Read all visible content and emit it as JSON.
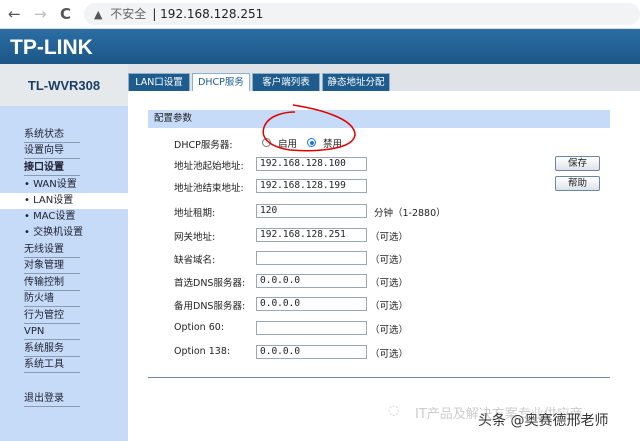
{
  "browser": {
    "back_icon": "←",
    "forward_icon": "→",
    "reload_icon": "C",
    "security_label": "不安全",
    "url": "192.168.128.251"
  },
  "header": {
    "logo": "TP-LINK",
    "model": "TL-WVR308"
  },
  "tabs": [
    {
      "label": "LAN口设置"
    },
    {
      "label": "DHCP服务",
      "active": true
    },
    {
      "label": "客户端列表"
    },
    {
      "label": "静态地址分配"
    }
  ],
  "sidebar": [
    {
      "label": "系统状态"
    },
    {
      "label": "设置向导"
    },
    {
      "label": "接口设置",
      "bold": true
    },
    {
      "label": "• WAN设置"
    },
    {
      "label": "• LAN设置",
      "selected": true
    },
    {
      "label": "• MAC设置"
    },
    {
      "label": "• 交换机设置"
    },
    {
      "label": "无线设置"
    },
    {
      "label": "对象管理"
    },
    {
      "label": "传输控制"
    },
    {
      "label": "防火墙"
    },
    {
      "label": "行为管控"
    },
    {
      "label": "VPN"
    },
    {
      "label": "系统服务"
    },
    {
      "label": "系统工具"
    },
    {
      "label": "退出登录"
    }
  ],
  "panel": {
    "title": "配置参数",
    "dhcp_label": "DHCP服务器:",
    "enable": "启用",
    "disable": "禁用",
    "selected": "禁用",
    "fields": [
      {
        "label": "地址池起始地址:",
        "value": "192.168.128.100",
        "hint": ""
      },
      {
        "label": "地址池结束地址:",
        "value": "192.168.128.199",
        "hint": ""
      },
      {
        "label": "地址租期:",
        "value": "120",
        "hint": "分钟（1-2880）"
      },
      {
        "label": "网关地址:",
        "value": "192.168.128.251",
        "hint": "（可选）"
      },
      {
        "label": "缺省域名:",
        "value": "",
        "hint": "（可选）"
      },
      {
        "label": "首选DNS服务器:",
        "value": "0.0.0.0",
        "hint": "（可选）"
      },
      {
        "label": "备用DNS服务器:",
        "value": "0.0.0.0",
        "hint": "（可选）"
      },
      {
        "label": "Option 60:",
        "value": "",
        "hint": "（可选）"
      },
      {
        "label": "Option 138:",
        "value": "0.0.0.0",
        "hint": "（可选）"
      }
    ],
    "save": "保存",
    "help": "帮助"
  },
  "watermark": {
    "line1": "IT产品及解决方案专业供应商",
    "line2": "头条 @奥赛德邢老师"
  },
  "colors": {
    "header": "#1c5687",
    "sidebar": "#c6dbf7",
    "annotation": "#e00000"
  }
}
